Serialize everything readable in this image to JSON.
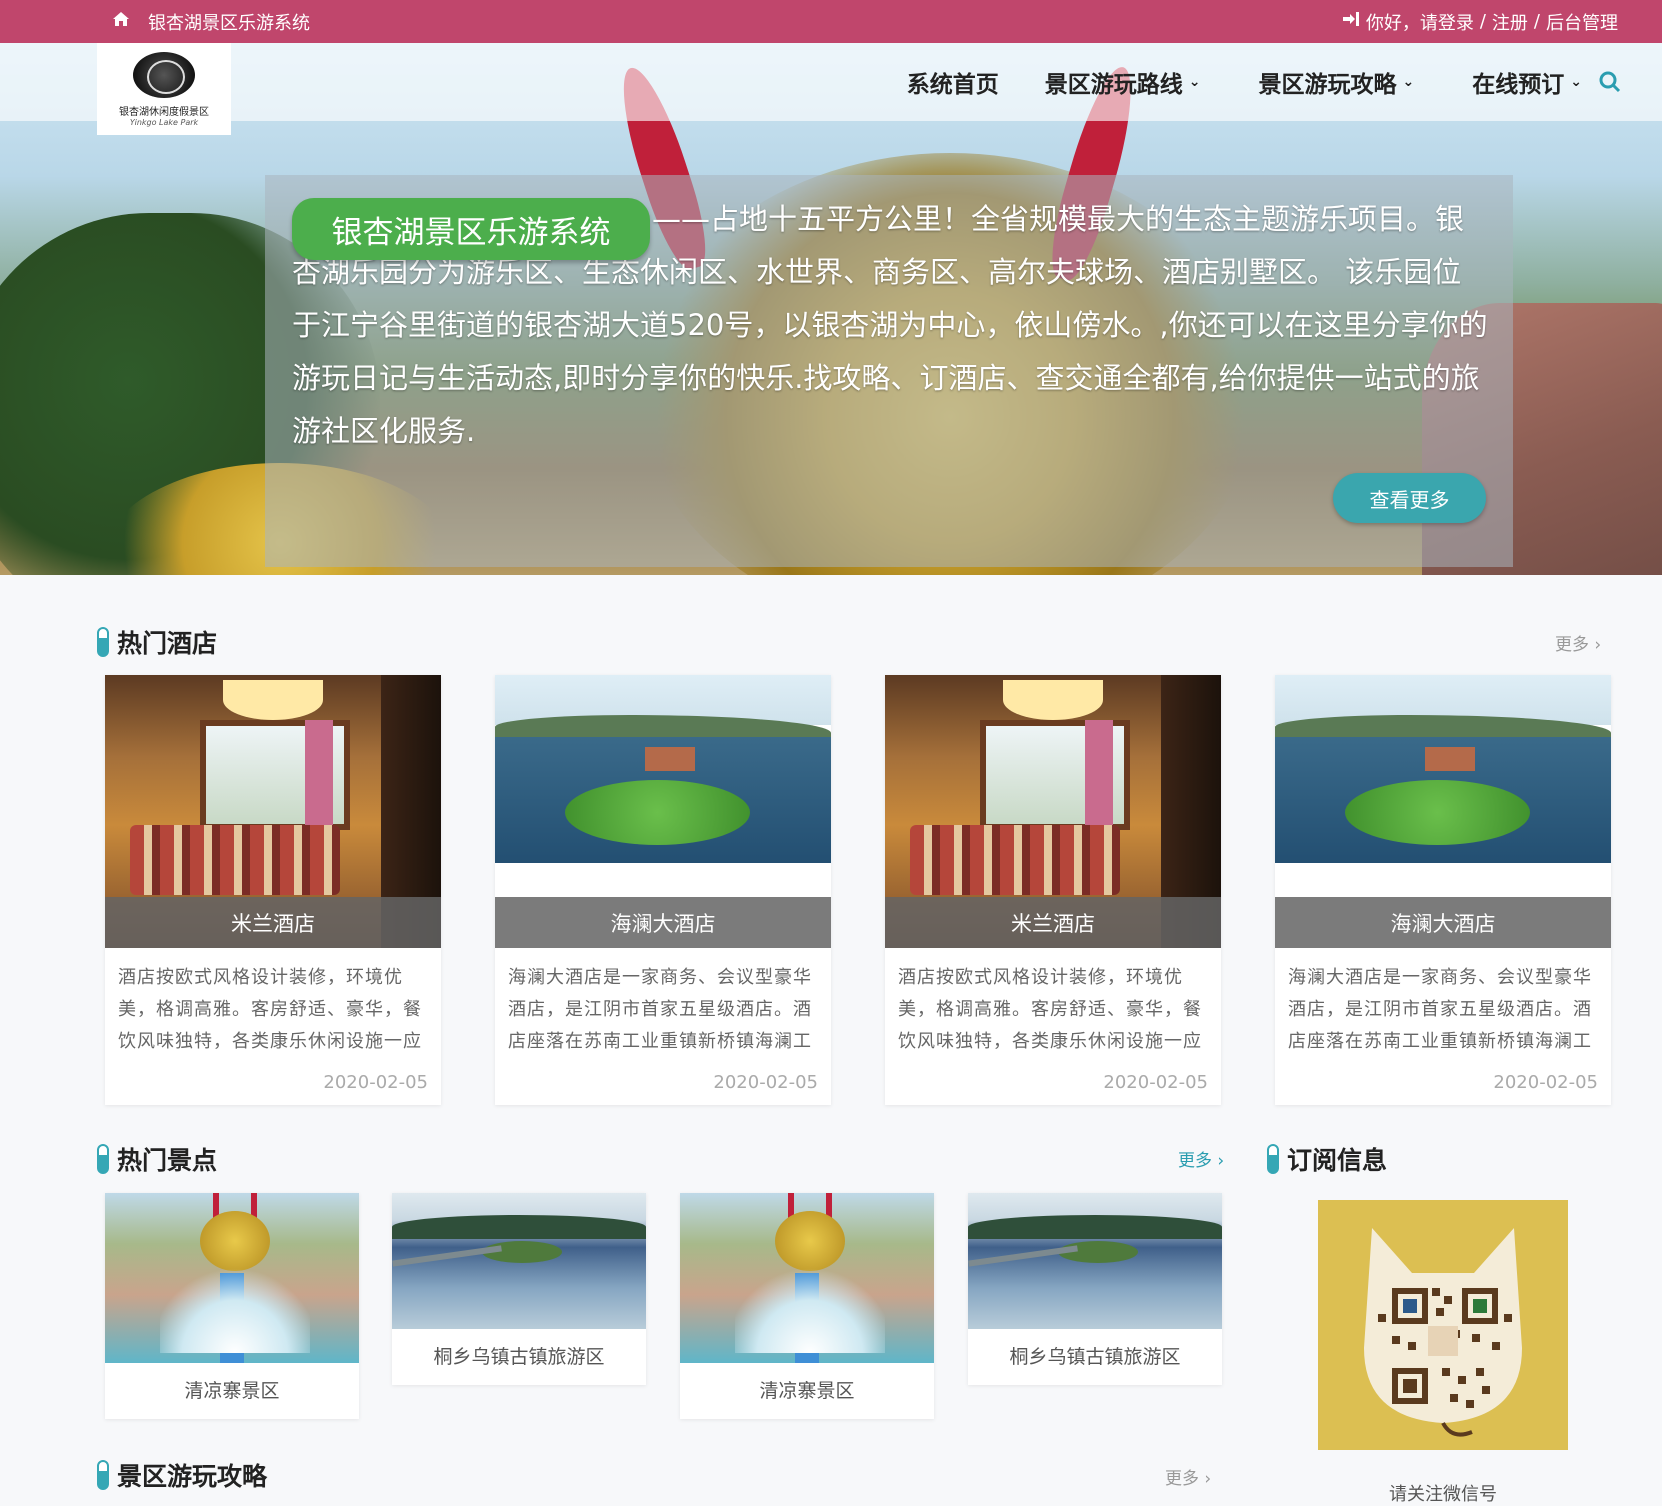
{
  "topbar": {
    "site_title": "银杏湖景区乐游系统",
    "greeting": "你好，请登录",
    "sep1": "/",
    "register": "注册",
    "sep2": "/",
    "admin": "后台管理"
  },
  "logo": {
    "name": "银杏湖休闲度假景区",
    "tagline": "Yinkgo Lake Park"
  },
  "nav": {
    "items": [
      {
        "label": "系统首页",
        "dropdown": false
      },
      {
        "label": "景区游玩路线",
        "dropdown": true
      },
      {
        "label": "景区游玩攻略",
        "dropdown": true
      },
      {
        "label": "在线预订",
        "dropdown": true
      }
    ]
  },
  "hero": {
    "badge": "银杏湖景区乐游系统",
    "intro": "——占地十五平方公里！全省规模最大的生态主题游乐项目。银杏湖乐园分为游乐区、生态休闲区、水世界、商务区、高尔夫球场、酒店别墅区。 该乐园位于江宁谷里街道的银杏湖大道520号，以银杏湖为中心，依山傍水。,你还可以在这里分享你的游玩日记与生活动态,即时分享你的快乐.找攻略、订酒店、查交通全都有,给你提供一站式的旅游社区化服务.",
    "more_button": "查看更多"
  },
  "hotels": {
    "title": "热门酒店",
    "more": "更多 ›",
    "cards": [
      {
        "name": "米兰酒店",
        "desc": "酒店按欧式风格设计装修，环境优美，格调高雅。客房舒适、豪华，餐饮风味独特，各类康乐休闲设施一应",
        "date": "2020-02-05",
        "image": "room"
      },
      {
        "name": "海澜大酒店",
        "desc": "海澜大酒店是一家商务、会议型豪华酒店，是江阴市首家五星级酒店。酒店座落在苏南工业重镇新桥镇海澜工",
        "date": "2020-02-05",
        "image": "lake"
      },
      {
        "name": "米兰酒店",
        "desc": "酒店按欧式风格设计装修，环境优美，格调高雅。客房舒适、豪华，餐饮风味独特，各类康乐休闲设施一应",
        "date": "2020-02-05",
        "image": "room"
      },
      {
        "name": "海澜大酒店",
        "desc": "海澜大酒店是一家商务、会议型豪华酒店，是江阴市首家五星级酒店。酒店座落在苏南工业重镇新桥镇海澜工",
        "date": "2020-02-05",
        "image": "lake"
      }
    ]
  },
  "scenic": {
    "title": "热门景点",
    "more": "更多 ›",
    "cards": [
      {
        "name": "清凉寨景区",
        "image": "dragon"
      },
      {
        "name": "桐乡乌镇古镇旅游区",
        "image": "town"
      },
      {
        "name": "清凉寨景区",
        "image": "dragon"
      },
      {
        "name": "桐乡乌镇古镇旅游区",
        "image": "town"
      }
    ]
  },
  "subscribe": {
    "title": "订阅信息",
    "caption": "请关注微信号"
  },
  "guides": {
    "title": "景区游玩攻略",
    "more": "更多 ›"
  },
  "colors": {
    "topbar": "#c0466c",
    "accent": "#35a7b5",
    "badge_green": "#4cae4c",
    "more_button": "#3aa6ae"
  }
}
